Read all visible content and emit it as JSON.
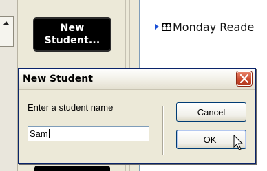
{
  "app": {
    "new_student_button_label": "New\nStudent...",
    "tree": {
      "item_label": "Monday Reade"
    }
  },
  "dialog": {
    "title": "New Student",
    "prompt": "Enter a student name",
    "input_value": "Sam",
    "cancel_label": "Cancel",
    "ok_label": "OK"
  },
  "icons": {
    "close": "close-icon",
    "tree_expander": "triangle-right-icon",
    "tree_group": "group-icon",
    "cursor": "mouse-pointer-icon"
  },
  "colors": {
    "close_button": "#c8472b",
    "tree_expander": "#1a4fd6",
    "input_border": "#7f9db9",
    "button_border": "#003c74"
  }
}
